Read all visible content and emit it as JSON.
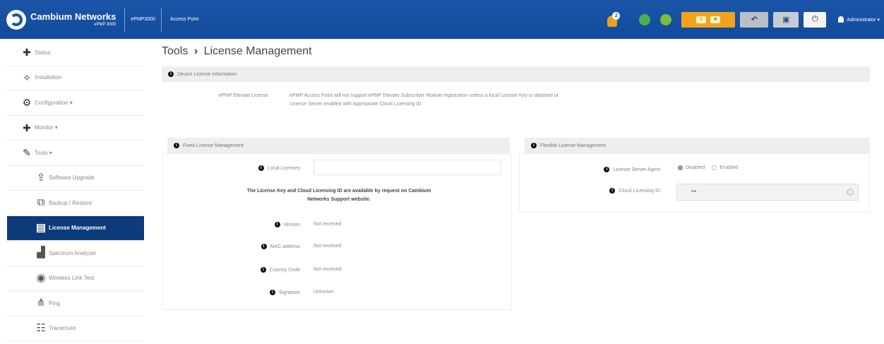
{
  "header": {
    "brand_name": "Cambium Networks",
    "brand_model": "ePMP 3000",
    "device_model": "ePMP3000",
    "device_mode": "Access Point",
    "alert_count": "2",
    "orange_count": "0",
    "admin_label": "Administrator ▾",
    "colors": {
      "topbar": "#1b56a8",
      "orange": "#f2a31b",
      "active_nav": "#0b3b78"
    }
  },
  "sidebar": {
    "items": [
      {
        "label": "Status",
        "icon": "pulse-icon"
      },
      {
        "label": "Installation",
        "icon": "run-icon"
      },
      {
        "label": "Configuration ▾",
        "icon": "gear-icon"
      },
      {
        "label": "Monitor ▾",
        "icon": "pulse-icon"
      },
      {
        "label": "Tools ▾",
        "icon": "wrench-icon"
      },
      {
        "label": "Software Upgrade",
        "icon": "upgrade-icon"
      },
      {
        "label": "Backup / Restore",
        "icon": "backup-icon"
      },
      {
        "label": "License Management",
        "icon": "license-icon"
      },
      {
        "label": "Spectrum Analyzer",
        "icon": "spectrum-icon"
      },
      {
        "label": "Wireless Link Test",
        "icon": "link-test-icon"
      },
      {
        "label": "Ping",
        "icon": "ping-icon"
      },
      {
        "label": "Traceroute",
        "icon": "traceroute-icon"
      }
    ]
  },
  "page": {
    "title_section": "Tools",
    "title_arrow": "›",
    "title_page": "License Management"
  },
  "device_license": {
    "header": "Device License Information",
    "label": "ePMP Elevate License",
    "text_line1": "ePMP Access Point will not support ePMP Elevate Subscriber Module registration unless a local License Key is obtained or",
    "text_line2": "License Server enabled with Appropriate Cloud Licensing ID"
  },
  "fixed_license": {
    "header": "Fixed License Management",
    "local_label": "Local Licenses",
    "local_value": "",
    "note_line1": "The License Key and Cloud Licensing ID are available by request on Cambium",
    "note_line2": "Networks Support website.",
    "rows": [
      {
        "label": "Version",
        "value": "Not received"
      },
      {
        "label": "MAC address",
        "value": "Not received"
      },
      {
        "label": "Country Code",
        "value": "Not received"
      },
      {
        "label": "Signature",
        "value": "Unknown"
      }
    ]
  },
  "flexible_license": {
    "header": "Flexible License Management",
    "agent_label": "License Server Agent",
    "agent_disabled": "Disabled",
    "agent_enabled": "Enabled",
    "agent_selected": "Disabled",
    "cloud_label": "Cloud Licensing ID",
    "cloud_value": "•••"
  }
}
